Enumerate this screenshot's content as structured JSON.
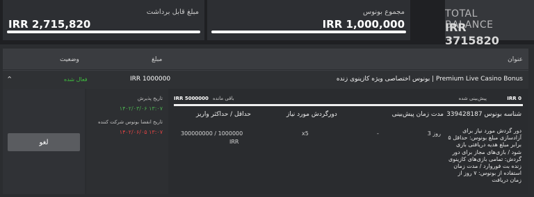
{
  "header": {
    "withdrawable_label": "مبلغ قابل برداشت",
    "withdrawable_value": "IRR 2,715,820",
    "bonus_total_label": "مجموع بونوس",
    "bonus_total_value": "IRR 1,000,000",
    "total_balance_title": "TOTAL BALANCE",
    "total_balance_value": "IRR 3715820"
  },
  "table": {
    "col_title": "عنوان",
    "col_amount": "مبلغ",
    "col_status": "وضعیت"
  },
  "bonus_row": {
    "name": "بونوس اختصاصی ویژه کازینوی زنده | Premium Live Casino Bonus",
    "amount": "IRR 1000000",
    "status": "فعال شده"
  },
  "details": {
    "cancel_label": "لغو",
    "accept_date_label": "تاریخ پذیرش",
    "accept_date_value": "۱۴۰۲/۰۳/۰۶ ۱۳:۰۷",
    "expiry_date_label": "تاریخ انقضا بونوس شرکت کننده",
    "expiry_date_value": "۱۴۰۲/۰۶/۰۵ ۱۳:۰۷",
    "wagered_label": "پیش‌بینی شده",
    "wagered_value": "IRR 0",
    "remaining_label": "باقی مانده",
    "remaining_value": "IRR 5000000",
    "wager_progress_percent": 0,
    "col_bonus_id": "شناسه بونوس 339428187",
    "col_duration": "مدت زمان پیش‌بینی",
    "col_turnover": "دورگردش مورد نیاز",
    "col_minmax": "حداقل / حداکثر واریز",
    "duration_value": "3 روز",
    "dash_value": "-",
    "turnover_value": "x5",
    "minmax_value": "300000000 / 1000000",
    "minmax_currency": "IRR",
    "description": "دور گردش مورد نیاز برای آزادسازی مبلغ بونوس: حداقل ۵ برابر مبلغ هدیه دریافتی بازی شود / بازی‌های مجاز برای دور گردش: تمامی بازی‌های کازینوی زنده بت فوروارد / مدت زمان استفاده از بونوس: ۷ روز از زمان دریافت"
  }
}
